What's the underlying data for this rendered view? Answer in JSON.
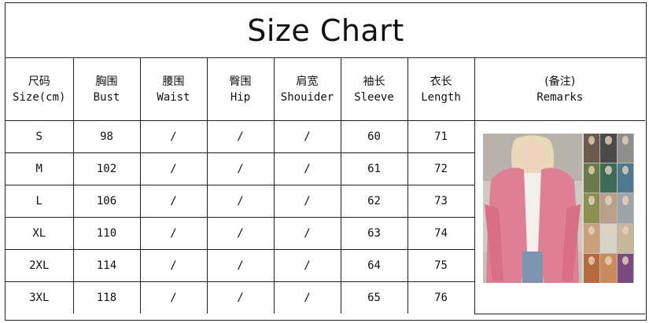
{
  "title": "Size Chart",
  "headers": [
    {
      "cn": "尺码",
      "en": "Size(cm)"
    },
    {
      "cn": "胸围",
      "en": "Bust"
    },
    {
      "cn": "腰围",
      "en": "Waist"
    },
    {
      "cn": "臀围",
      "en": "Hip"
    },
    {
      "cn": "肩宽",
      "en": "Shouider"
    },
    {
      "cn": "袖长",
      "en": "Sleeve"
    },
    {
      "cn": "衣长",
      "en": "Length"
    },
    {
      "cn": "(备注)",
      "en": "Remarks"
    }
  ],
  "rows": [
    [
      "S",
      "98",
      "/",
      "/",
      "/",
      "60",
      "71"
    ],
    [
      "M",
      "102",
      "/",
      "/",
      "/",
      "61",
      "72"
    ],
    [
      "L",
      "106",
      "/",
      "/",
      "/",
      "62",
      "73"
    ],
    [
      "XL",
      "110",
      "/",
      "/",
      "/",
      "63",
      "74"
    ],
    [
      "2XL",
      "114",
      "/",
      "/",
      "/",
      "64",
      "75"
    ],
    [
      "3XL",
      "118",
      "/",
      "/",
      "/",
      "65",
      "76"
    ]
  ],
  "photo": {
    "main_color": "#e07e93",
    "swatch_colors": [
      "#6b5a4e",
      "#4a4a4a",
      "#8e8e8e",
      "#6b7a4a",
      "#3d6b54",
      "#4d7a8e",
      "#8a8f52",
      "#b8a08a",
      "#9fa4a8",
      "#c9a07a",
      "#d8d2c8",
      "#c8b69a",
      "#b46a3e",
      "#c98a5c",
      "#7a4a7e"
    ]
  }
}
